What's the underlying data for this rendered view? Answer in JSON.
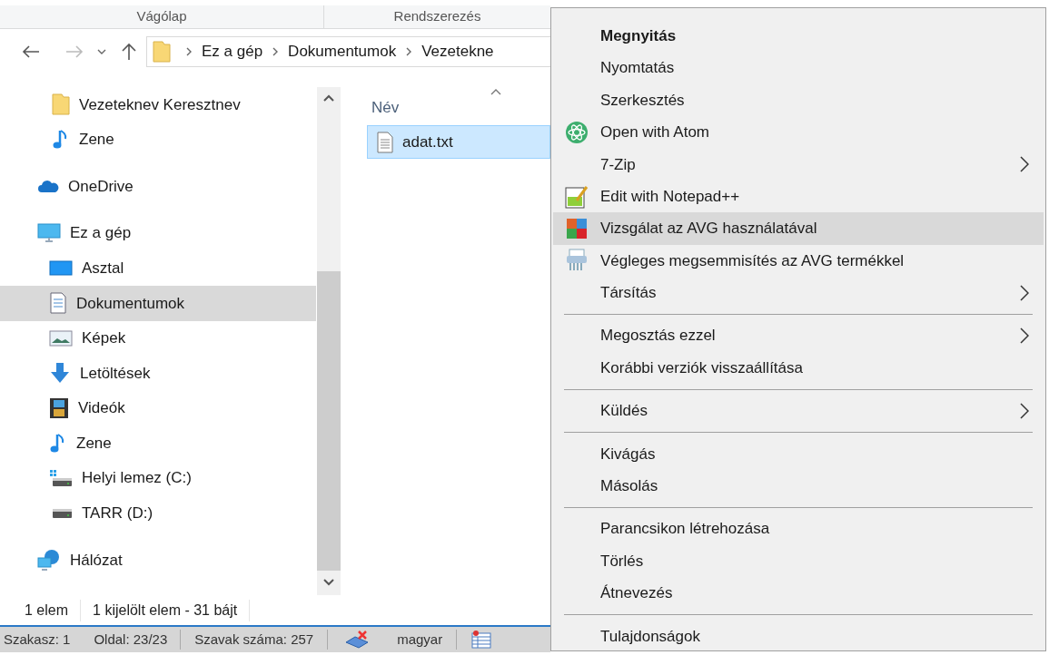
{
  "ribbon_groups": [
    "Vágólap",
    "Rendszerezés"
  ],
  "address": {
    "breadcrumbs": [
      "Ez a gép",
      "Dokumentumok",
      "Vezetekne"
    ]
  },
  "nav": {
    "quick_access_children": [
      {
        "label": "Vezeteknev Keresztnev",
        "selected": false
      },
      {
        "label": "Zene",
        "selected": false
      }
    ],
    "items": [
      {
        "label": "OneDrive",
        "selected": false
      },
      {
        "label": "Ez a gép",
        "selected": false,
        "children": [
          {
            "label": "Asztal",
            "selected": false
          },
          {
            "label": "Dokumentumok",
            "selected": true
          },
          {
            "label": "Képek",
            "selected": false
          },
          {
            "label": "Letöltések",
            "selected": false
          },
          {
            "label": "Videók",
            "selected": false
          },
          {
            "label": "Zene",
            "selected": false
          },
          {
            "label": "Helyi lemez (C:)",
            "selected": false
          },
          {
            "label": "TARR (D:)",
            "selected": false
          }
        ]
      },
      {
        "label": "Hálózat",
        "selected": false
      }
    ]
  },
  "columns": [
    "Név"
  ],
  "files": [
    {
      "name": "adat.txt",
      "selected": true
    }
  ],
  "status_bar": [
    "1 elem",
    "1 kijelölt elem - 31 bájt"
  ],
  "word_status_bar": [
    "Szakasz: 1",
    "Oldal: 23/23",
    "Szavak száma: 257",
    "magyar"
  ],
  "context_menu": {
    "items": [
      {
        "kind": "item",
        "label": "Megnyitás",
        "default": true,
        "selected": false,
        "submenu": false
      },
      {
        "kind": "item",
        "label": "Nyomtatás",
        "default": false,
        "selected": false,
        "submenu": false
      },
      {
        "kind": "item",
        "label": "Szerkesztés",
        "default": false,
        "selected": false,
        "submenu": false
      },
      {
        "kind": "item",
        "label": "Open with Atom",
        "default": false,
        "selected": false,
        "submenu": false
      },
      {
        "kind": "item",
        "label": "7-Zip",
        "default": false,
        "selected": false,
        "submenu": true
      },
      {
        "kind": "item",
        "label": "Edit with Notepad++",
        "default": false,
        "selected": false,
        "submenu": false
      },
      {
        "kind": "item",
        "label": "Vizsgálat az AVG használatával",
        "default": false,
        "selected": true,
        "submenu": false
      },
      {
        "kind": "item",
        "label": "Végleges megsemmisítés az AVG termékkel",
        "default": false,
        "selected": false,
        "submenu": false
      },
      {
        "kind": "item",
        "label": "Társítás",
        "default": false,
        "selected": false,
        "submenu": true
      },
      {
        "kind": "separator"
      },
      {
        "kind": "item",
        "label": "Megosztás ezzel",
        "default": false,
        "selected": false,
        "submenu": true
      },
      {
        "kind": "item",
        "label": "Korábbi verziók visszaállítása",
        "default": false,
        "selected": false,
        "submenu": false
      },
      {
        "kind": "separator"
      },
      {
        "kind": "item",
        "label": "Küldés",
        "default": false,
        "selected": false,
        "submenu": true
      },
      {
        "kind": "separator"
      },
      {
        "kind": "item",
        "label": "Kivágás",
        "default": false,
        "selected": false,
        "submenu": false
      },
      {
        "kind": "item",
        "label": "Másolás",
        "default": false,
        "selected": false,
        "submenu": false
      },
      {
        "kind": "separator"
      },
      {
        "kind": "item",
        "label": "Parancsikon létrehozása",
        "default": false,
        "selected": false,
        "submenu": false
      },
      {
        "kind": "item",
        "label": "Törlés",
        "default": false,
        "selected": false,
        "submenu": false
      },
      {
        "kind": "item",
        "label": "Átnevezés",
        "default": false,
        "selected": false,
        "submenu": false
      },
      {
        "kind": "separator"
      },
      {
        "kind": "item",
        "label": "Tulajdonságok",
        "default": false,
        "selected": false,
        "submenu": false
      }
    ]
  }
}
